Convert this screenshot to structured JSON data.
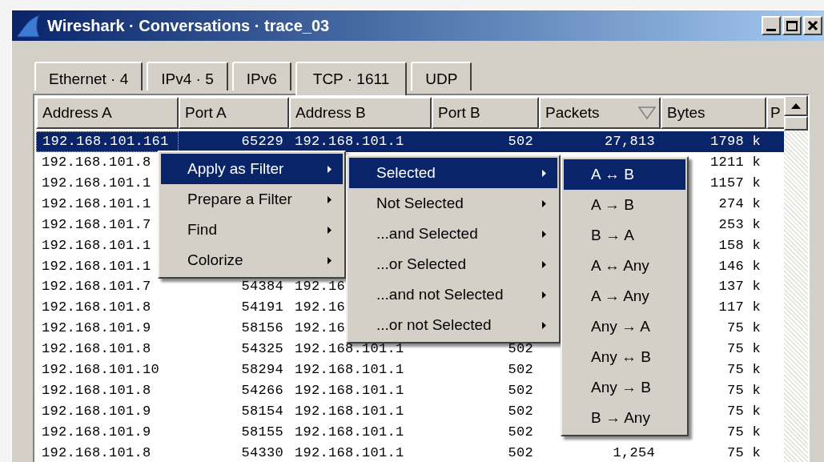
{
  "window": {
    "title": "Wireshark · Conversations · trace_03"
  },
  "tabs": [
    {
      "label": "Ethernet · 4",
      "selected": false
    },
    {
      "label": "IPv4 · 5",
      "selected": false
    },
    {
      "label": "IPv6",
      "selected": false
    },
    {
      "label": "TCP · 1611",
      "selected": true
    },
    {
      "label": "UDP",
      "selected": false
    }
  ],
  "table": {
    "columns": [
      {
        "label": "Address A",
        "sorted": false
      },
      {
        "label": "Port A",
        "sorted": false
      },
      {
        "label": "Address B",
        "sorted": false
      },
      {
        "label": "Port B",
        "sorted": false
      },
      {
        "label": "Packets",
        "sorted": true
      },
      {
        "label": "Bytes",
        "sorted": false
      },
      {
        "label": "P",
        "sorted": false
      }
    ],
    "rows": [
      {
        "selected": true,
        "cells": [
          "192.168.101.161",
          "65229",
          "192.168.101.1",
          "502",
          "27,813",
          "1798 k"
        ]
      },
      {
        "selected": false,
        "cells": [
          "192.168.101.8",
          null,
          null,
          null,
          null,
          "1211 k"
        ]
      },
      {
        "selected": false,
        "cells": [
          "192.168.101.1",
          null,
          null,
          null,
          null,
          "1157 k"
        ]
      },
      {
        "selected": false,
        "cells": [
          "192.168.101.1",
          null,
          null,
          null,
          null,
          "274 k"
        ]
      },
      {
        "selected": false,
        "cells": [
          "192.168.101.7",
          null,
          null,
          null,
          null,
          "253 k"
        ]
      },
      {
        "selected": false,
        "cells": [
          "192.168.101.1",
          null,
          null,
          null,
          null,
          "158 k"
        ]
      },
      {
        "selected": false,
        "cells": [
          "192.168.101.1",
          null,
          null,
          null,
          null,
          "146 k"
        ]
      },
      {
        "selected": false,
        "cells": [
          "192.168.101.7",
          "54384",
          "192.16",
          null,
          null,
          "137 k"
        ]
      },
      {
        "selected": false,
        "cells": [
          "192.168.101.8",
          "54191",
          "192.16",
          null,
          null,
          "117 k"
        ]
      },
      {
        "selected": false,
        "cells": [
          "192.168.101.9",
          "58156",
          "192.16",
          null,
          null,
          "75 k"
        ]
      },
      {
        "selected": false,
        "cells": [
          "192.168.101.8",
          "54325",
          "192.168.101.1",
          "502",
          null,
          "75 k"
        ]
      },
      {
        "selected": false,
        "cells": [
          "192.168.101.10",
          "58294",
          "192.168.101.1",
          "502",
          null,
          "75 k"
        ]
      },
      {
        "selected": false,
        "cells": [
          "192.168.101.8",
          "54266",
          "192.168.101.1",
          "502",
          null,
          "75 k"
        ]
      },
      {
        "selected": false,
        "cells": [
          "192.168.101.9",
          "58154",
          "192.168.101.1",
          "502",
          null,
          "75 k"
        ]
      },
      {
        "selected": false,
        "cells": [
          "192.168.101.9",
          "58155",
          "192.168.101.1",
          "502",
          null,
          "75 k"
        ]
      },
      {
        "selected": false,
        "cells": [
          "192.168.101.8",
          "54330",
          "192.168.101.1",
          "502",
          "1,254",
          "75 k"
        ]
      }
    ]
  },
  "context_menus": [
    {
      "items": [
        {
          "label": "Apply as Filter",
          "selected": true,
          "has_submenu": true
        },
        {
          "label": "Prepare a Filter",
          "selected": false,
          "has_submenu": true
        },
        {
          "label": "Find",
          "selected": false,
          "has_submenu": true
        },
        {
          "label": "Colorize",
          "selected": false,
          "has_submenu": true
        }
      ]
    },
    {
      "items": [
        {
          "label": "Selected",
          "selected": true,
          "has_submenu": true
        },
        {
          "label": "Not Selected",
          "selected": false,
          "has_submenu": true
        },
        {
          "label": "...and Selected",
          "selected": false,
          "has_submenu": true
        },
        {
          "label": "...or Selected",
          "selected": false,
          "has_submenu": true
        },
        {
          "label": "...and not Selected",
          "selected": false,
          "has_submenu": true
        },
        {
          "label": "...or not Selected",
          "selected": false,
          "has_submenu": true
        }
      ]
    },
    {
      "items": [
        {
          "label": "A ↔ B",
          "selected": true,
          "has_submenu": false
        },
        {
          "label": "A → B",
          "selected": false,
          "has_submenu": false
        },
        {
          "label": "B → A",
          "selected": false,
          "has_submenu": false
        },
        {
          "label": "A ↔ Any",
          "selected": false,
          "has_submenu": false
        },
        {
          "label": "A → Any",
          "selected": false,
          "has_submenu": false
        },
        {
          "label": "Any → A",
          "selected": false,
          "has_submenu": false
        },
        {
          "label": "Any ↔ B",
          "selected": false,
          "has_submenu": false
        },
        {
          "label": "Any → B",
          "selected": false,
          "has_submenu": false
        },
        {
          "label": "B → Any",
          "selected": false,
          "has_submenu": false
        }
      ]
    }
  ]
}
